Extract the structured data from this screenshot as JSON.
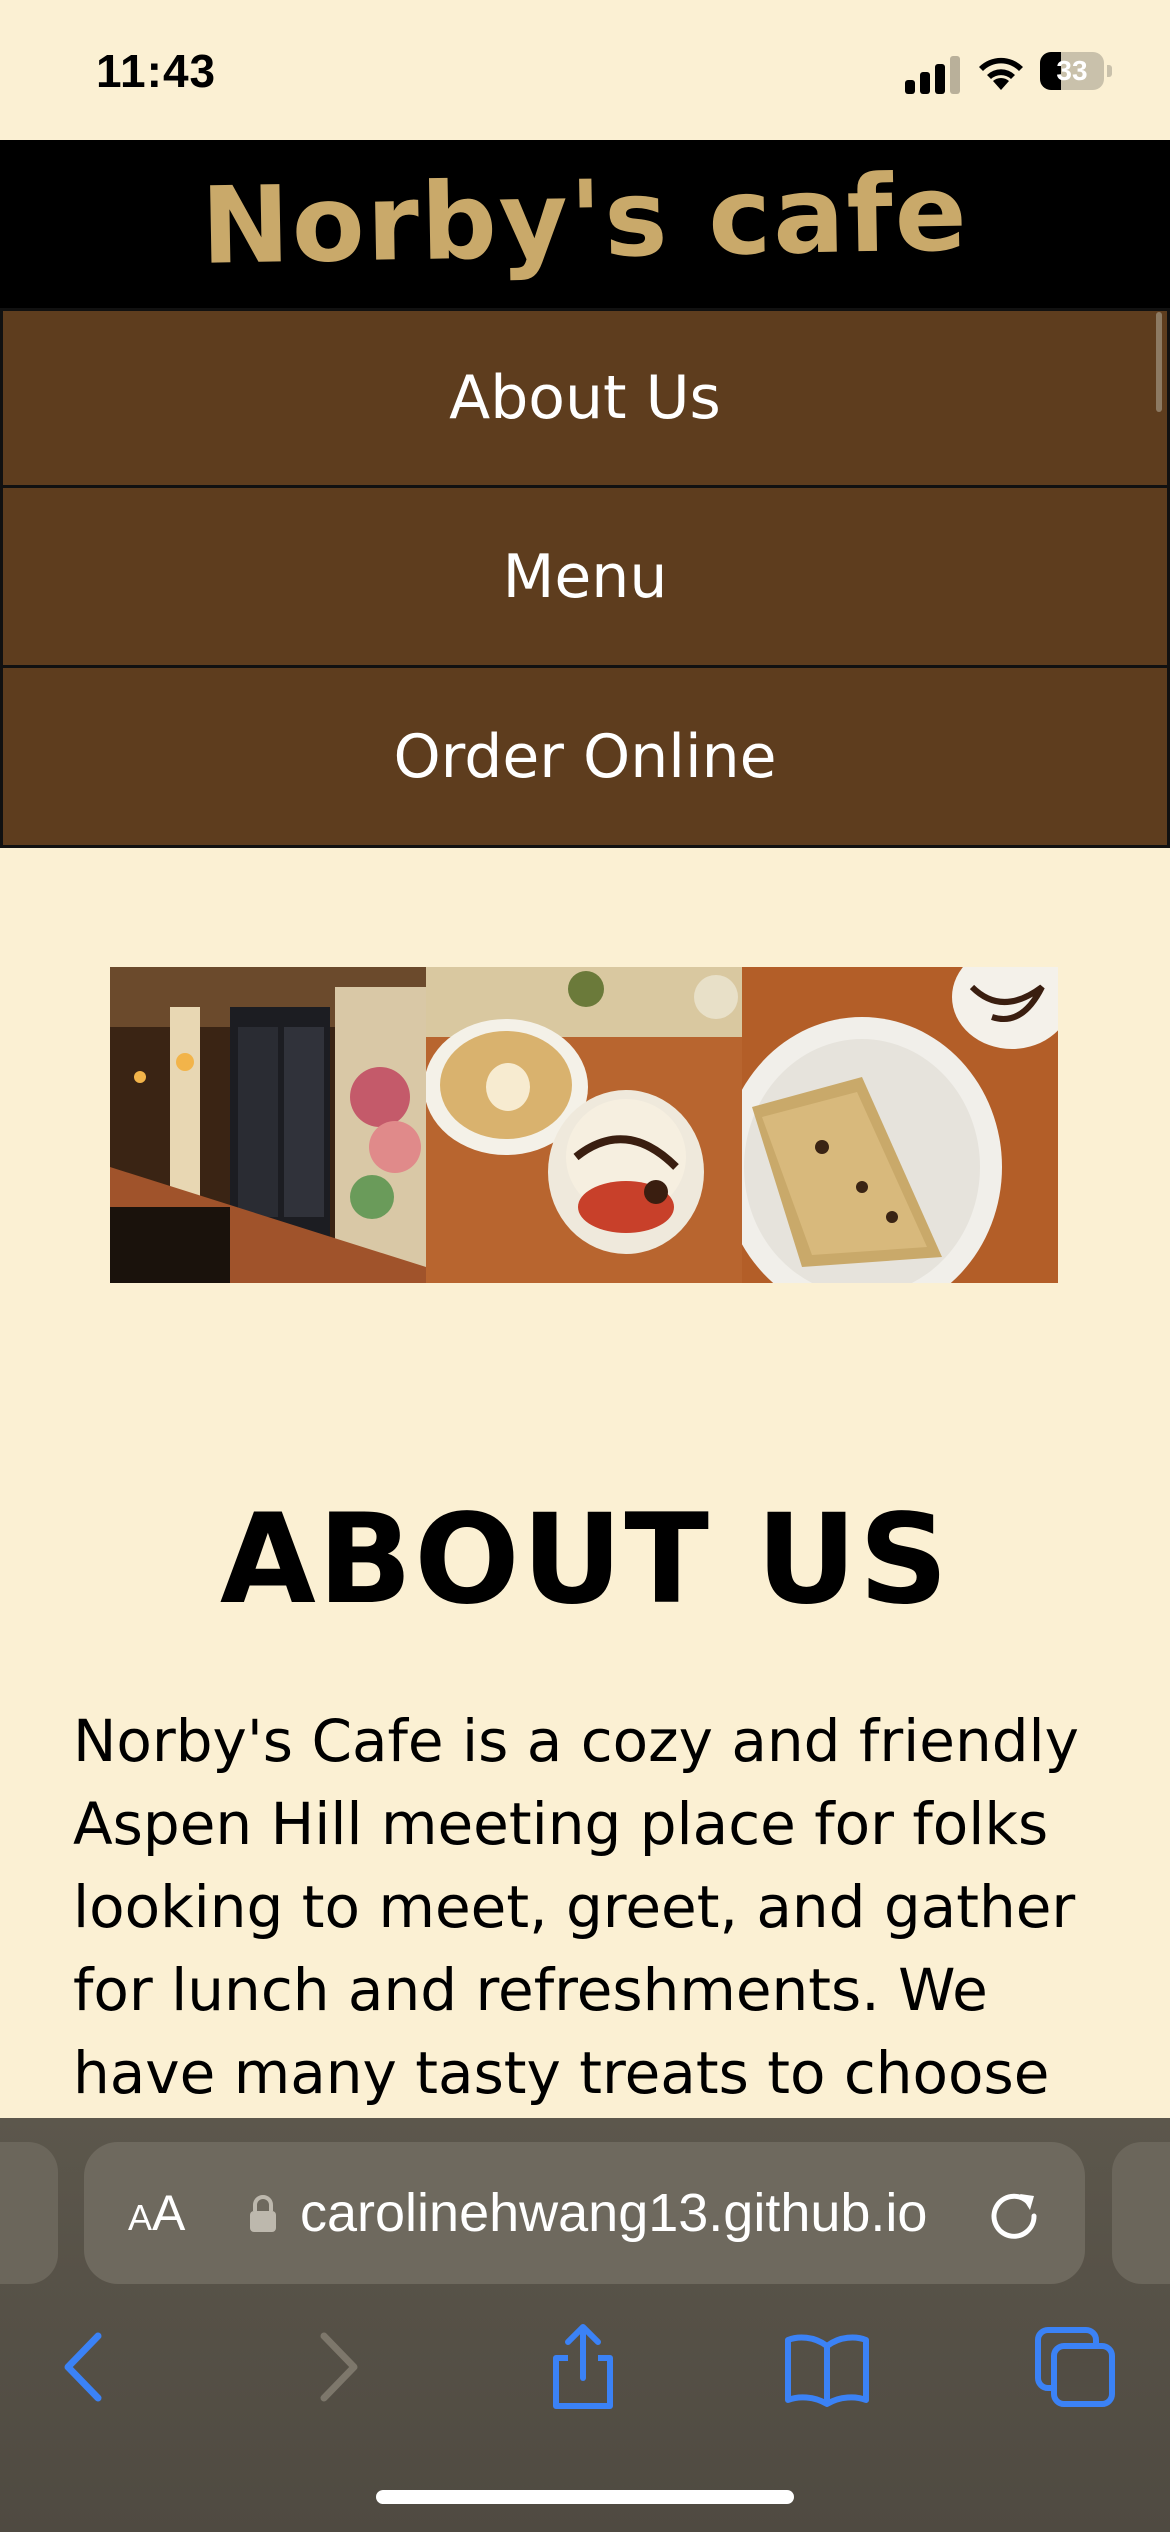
{
  "status_bar": {
    "time": "11:43",
    "battery_level": "33",
    "battery_fraction": 0.33,
    "signal_bars_active": 3,
    "signal_bars_total": 4
  },
  "header": {
    "logo_text": "Norby's cafe"
  },
  "nav": {
    "items": [
      {
        "label": "About Us"
      },
      {
        "label": "Menu"
      },
      {
        "label": "Order Online"
      }
    ]
  },
  "hero": {
    "images": [
      "cafe-interior-photo",
      "latte-and-dessert-photo",
      "scone-photo"
    ]
  },
  "about": {
    "title": "ABOUT US",
    "text": "Norby's Cafe is a cozy and friendly Aspen Hill meeting place for folks looking to meet, greet, and gather for lunch and refreshments. We have many tasty treats to choose"
  },
  "browser": {
    "aa_small": "A",
    "aa_big": "A",
    "url": "carolinehwang13.github.io",
    "icons": [
      "lock-icon",
      "reload-icon",
      "back-icon",
      "forward-icon",
      "share-icon",
      "bookmarks-icon",
      "tabs-icon"
    ]
  },
  "colors": {
    "page_background": "#fbf0d3",
    "nav_background": "#5e3d1e",
    "logo_color": "#c9a96a",
    "link_blue": "#3b82f6"
  }
}
